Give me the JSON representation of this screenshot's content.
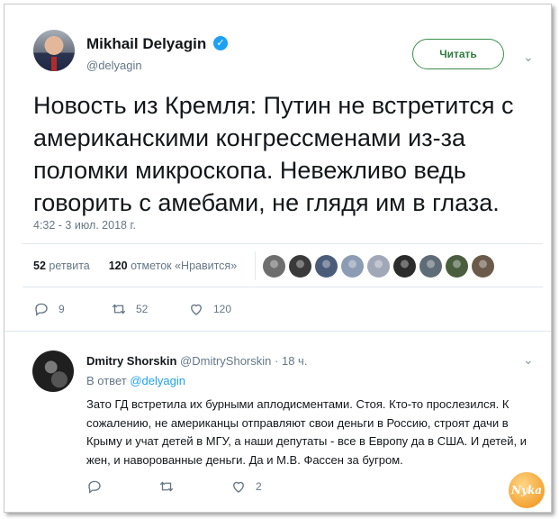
{
  "tweet": {
    "author_name": "Mikhail Delyagin",
    "author_handle": "@delyagin",
    "follow_label": "Читать",
    "text": "Новость из Кремля: Путин не встретится с американскими конгрессменами из-за поломки микроскопа. Невежливо ведь говорить с амебами, не глядя им в глаза.",
    "timestamp": "4:32 - 3 июл. 2018 г.",
    "retweets_count": "52",
    "retweets_label": "ретвита",
    "likes_count": "120",
    "likes_label": "отметок «Нравится»",
    "liker_avatar_colors": [
      "#6e6e6e",
      "#3a3a3a",
      "#4b5b7a",
      "#8b9cb3",
      "#a0a8b8",
      "#2b2b2b",
      "#5f6b76",
      "#4a5d3f",
      "#6b5a4a"
    ],
    "actions": {
      "reply": "9",
      "retweet": "52",
      "like": "120"
    }
  },
  "reply": {
    "author_name": "Dmitry Shorskin",
    "author_handle": "@DmitryShorskin",
    "separator": "·",
    "time": "18 ч.",
    "reply_prefix": "В ответ",
    "reply_handle": "@delyagin",
    "text": "Зато ГД встретила их бурными аплодисментами. Стоя. Кто-то  прослезился. К сожалению, не американцы отправляют свои деньги в Россию, строят дачи в Крыму и учат детей в МГУ, а наши депутаты - все в Европу да в США. И детей, и жен, и наворованные деньги. Да и М.В. Фассен за бугром.",
    "actions": {
      "reply": "",
      "retweet": "",
      "like": "2"
    }
  },
  "watermark_text": "Nyka",
  "colors": {
    "accent_blue": "#1da1f2",
    "follow_green": "#2e7d3c",
    "muted_gray": "#657786"
  }
}
